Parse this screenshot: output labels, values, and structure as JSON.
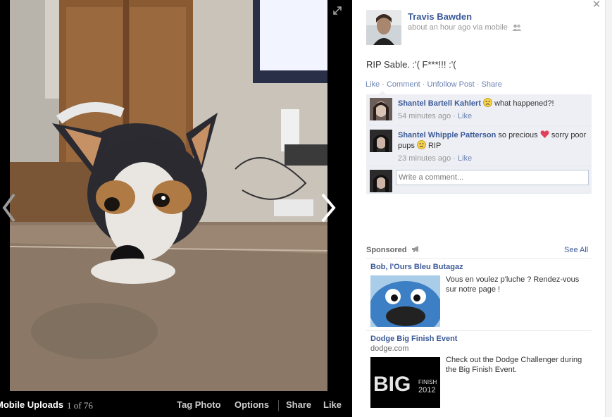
{
  "photo_bar": {
    "album": "Mobile Uploads",
    "counter": "1 of 76",
    "tag_photo": "Tag Photo",
    "options": "Options",
    "share": "Share",
    "like": "Like"
  },
  "post": {
    "author": "Travis Bawden",
    "meta": "about an hour ago via mobile",
    "text": "RIP Sable. :'( F***!!! :'(",
    "actions": [
      "Like",
      "Comment",
      "Unfollow Post",
      "Share"
    ]
  },
  "comments": [
    {
      "author": "Shantel Bartell Kahlert",
      "text_after": "what happened?!",
      "time": "54 minutes ago",
      "like": "Like"
    },
    {
      "author": "Shantel Whipple Patterson",
      "text_before": "so precious",
      "text_middle": "sorry poor pups",
      "text_after": "RIP",
      "time": "23 minutes ago",
      "like": "Like"
    }
  ],
  "comment_box": {
    "placeholder": "Write a comment..."
  },
  "sponsored": {
    "heading": "Sponsored",
    "see_all": "See All",
    "ads": [
      {
        "title": "Bob, l'Ours Bleu Butagaz",
        "body": "Vous en voulez p'luche ? Rendez-vous sur notre page !"
      },
      {
        "title": "Dodge Big Finish Event",
        "domain": "dodge.com",
        "body": "Check out the Dodge Challenger during the Big Finish Event.",
        "image_text": "BIG",
        "image_sub1": "FINISH",
        "image_sub2": "2012"
      }
    ]
  },
  "icons": {
    "prev": "chevron-left-icon",
    "next": "chevron-right-icon",
    "expand": "expand-icon",
    "close": "close-icon",
    "audience": "friends-icon",
    "megaphone": "megaphone-icon"
  },
  "colors": {
    "link": "#3b5998",
    "ufi_bg": "#edeff4",
    "stage_bg": "#000000"
  }
}
